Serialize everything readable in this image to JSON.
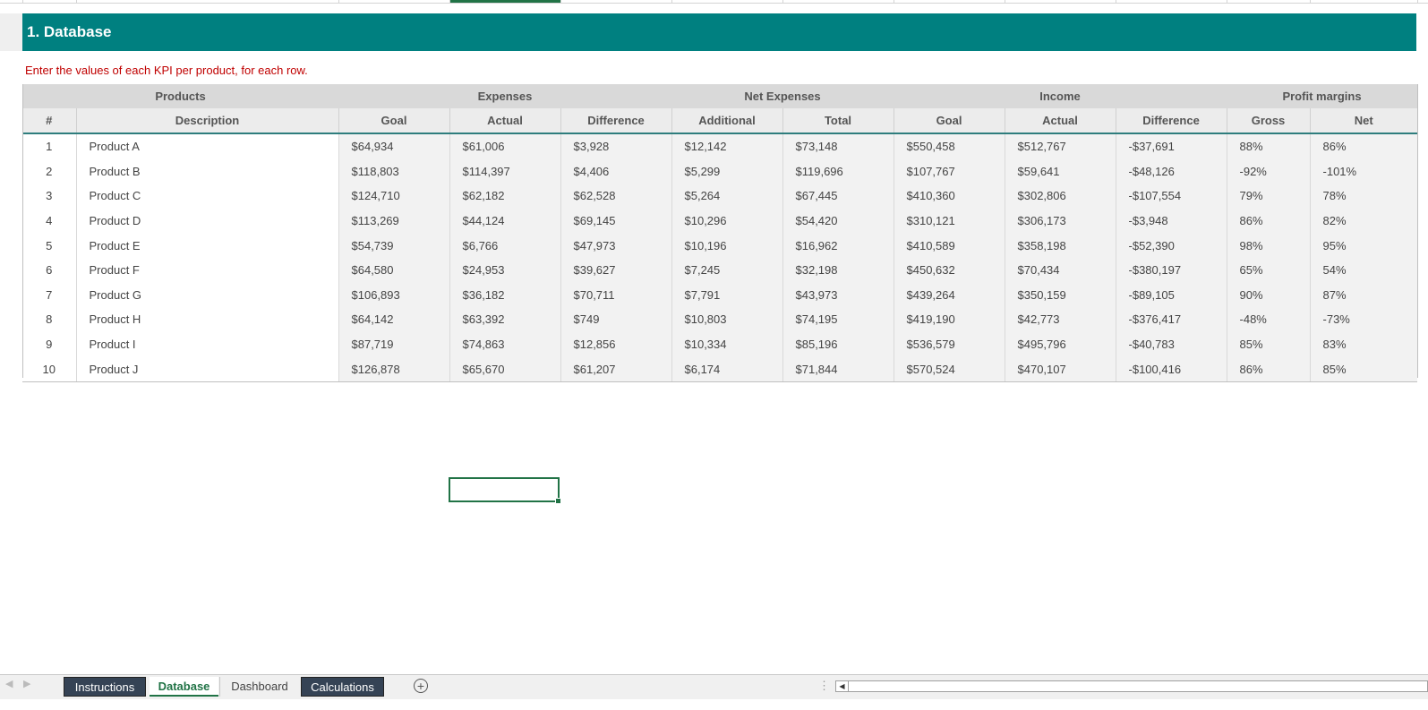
{
  "title": "1. Database",
  "instruction": "Enter the values of each KPI per product, for each row.",
  "table": {
    "group_headers": [
      "Products",
      "Expenses",
      "Net Expenses",
      "Income",
      "Profit margins"
    ],
    "columns": [
      "#",
      "Description",
      "Goal",
      "Actual",
      "Difference",
      "Additional",
      "Total",
      "Goal",
      "Actual",
      "Difference",
      "Gross",
      "Net"
    ],
    "rows": [
      [
        "1",
        "Product A",
        "$64,934",
        "$61,006",
        "$3,928",
        "$12,142",
        "$73,148",
        "$550,458",
        "$512,767",
        "-$37,691",
        "88%",
        "86%"
      ],
      [
        "2",
        "Product B",
        "$118,803",
        "$114,397",
        "$4,406",
        "$5,299",
        "$119,696",
        "$107,767",
        "$59,641",
        "-$48,126",
        "-92%",
        "-101%"
      ],
      [
        "3",
        "Product C",
        "$124,710",
        "$62,182",
        "$62,528",
        "$5,264",
        "$67,445",
        "$410,360",
        "$302,806",
        "-$107,554",
        "79%",
        "78%"
      ],
      [
        "4",
        "Product D",
        "$113,269",
        "$44,124",
        "$69,145",
        "$10,296",
        "$54,420",
        "$310,121",
        "$306,173",
        "-$3,948",
        "86%",
        "82%"
      ],
      [
        "5",
        "Product E",
        "$54,739",
        "$6,766",
        "$47,973",
        "$10,196",
        "$16,962",
        "$410,589",
        "$358,198",
        "-$52,390",
        "98%",
        "95%"
      ],
      [
        "6",
        "Product F",
        "$64,580",
        "$24,953",
        "$39,627",
        "$7,245",
        "$32,198",
        "$450,632",
        "$70,434",
        "-$380,197",
        "65%",
        "54%"
      ],
      [
        "7",
        "Product G",
        "$106,893",
        "$36,182",
        "$70,711",
        "$7,791",
        "$43,973",
        "$439,264",
        "$350,159",
        "-$89,105",
        "90%",
        "87%"
      ],
      [
        "8",
        "Product H",
        "$64,142",
        "$63,392",
        "$749",
        "$10,803",
        "$74,195",
        "$419,190",
        "$42,773",
        "-$376,417",
        "-48%",
        "-73%"
      ],
      [
        "9",
        "Product I",
        "$87,719",
        "$74,863",
        "$12,856",
        "$10,334",
        "$85,196",
        "$536,579",
        "$495,796",
        "-$40,783",
        "85%",
        "83%"
      ],
      [
        "10",
        "Product J",
        "$126,878",
        "$65,670",
        "$61,207",
        "$6,174",
        "$71,844",
        "$570,524",
        "$470,107",
        "-$100,416",
        "86%",
        "85%"
      ]
    ]
  },
  "sheet_tabs": [
    "Instructions",
    "Database",
    "Dashboard",
    "Calculations"
  ],
  "active_tab": "Database",
  "colors": {
    "title_bar": "#008080",
    "instruction_text": "#c00000",
    "accent": "#217346",
    "dark_tab": "#354355"
  },
  "icons": {
    "add_sheet": "plus-circle-icon",
    "scroll_left": "scroll-left-icon",
    "nav_prev": "chevron-left-icon",
    "nav_next": "chevron-right-icon"
  }
}
